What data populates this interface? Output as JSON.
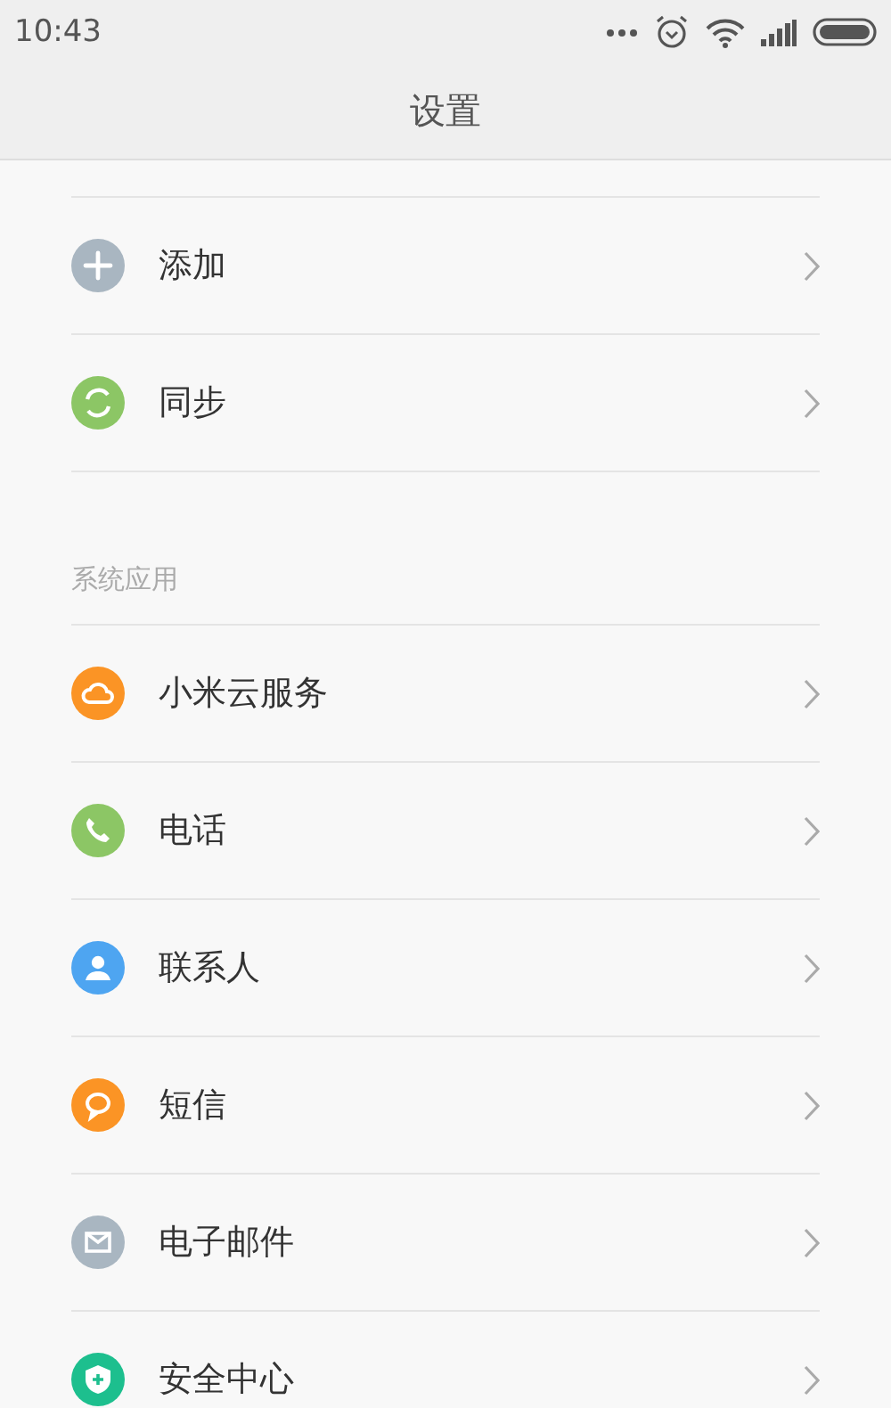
{
  "status_bar": {
    "time": "10:43"
  },
  "title": "设置",
  "groups": [
    {
      "items": [
        {
          "label": "添加",
          "kind": "plus",
          "color": "#a9b6c1"
        },
        {
          "label": "同步",
          "kind": "sync",
          "color": "#8cc665"
        }
      ]
    },
    {
      "header": "系统应用",
      "items": [
        {
          "label": "小米云服务",
          "kind": "cloud",
          "color": "#fb9425"
        },
        {
          "label": "电话",
          "kind": "phone",
          "color": "#8cc665"
        },
        {
          "label": "联系人",
          "kind": "person",
          "color": "#4ea5f1"
        },
        {
          "label": "短信",
          "kind": "chat",
          "color": "#fb9425"
        },
        {
          "label": "电子邮件",
          "kind": "mail",
          "color": "#a9b6c1"
        },
        {
          "label": "安全中心",
          "kind": "shield",
          "color": "#1dbf8e"
        }
      ]
    }
  ]
}
